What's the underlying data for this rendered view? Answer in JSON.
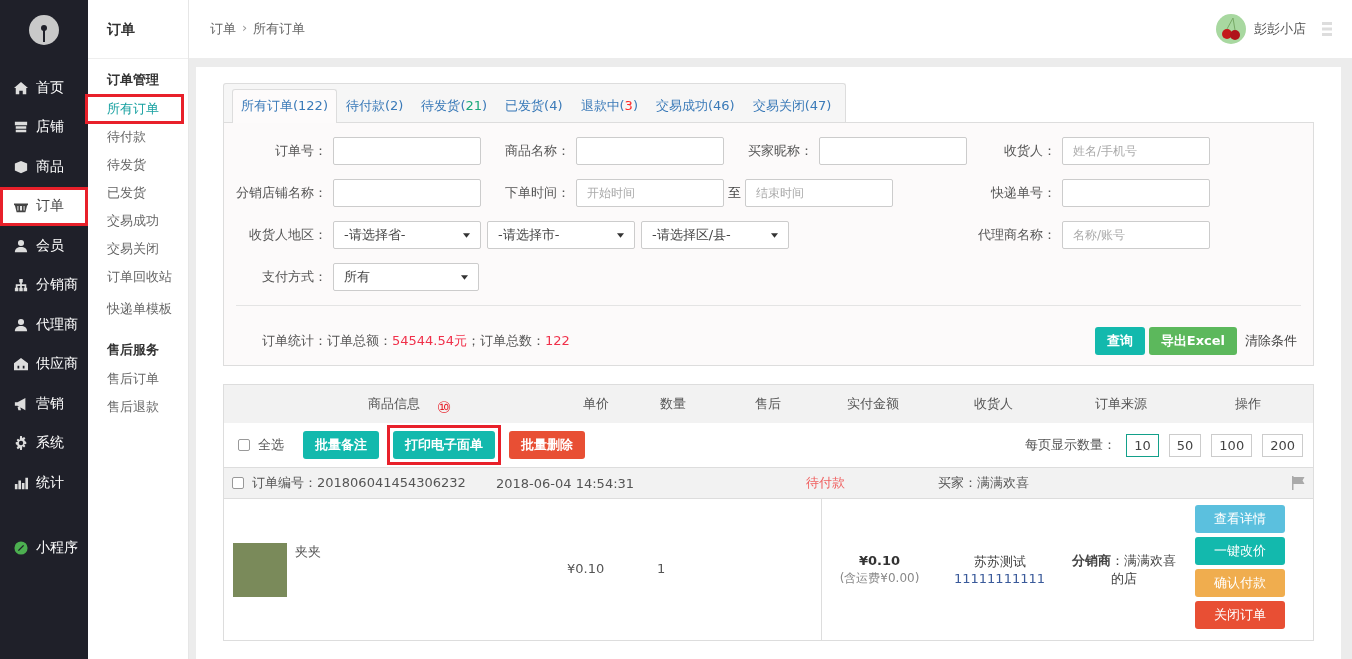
{
  "sidebar": {
    "items": [
      {
        "label": "首页",
        "selected": false,
        "highlighted": false
      },
      {
        "label": "店铺",
        "selected": false,
        "highlighted": false
      },
      {
        "label": "商品",
        "selected": false,
        "highlighted": false
      },
      {
        "label": "订单",
        "selected": true,
        "highlighted": true
      },
      {
        "label": "会员",
        "selected": false,
        "highlighted": false
      },
      {
        "label": "分销商",
        "selected": false,
        "highlighted": false
      },
      {
        "label": "代理商",
        "selected": false,
        "highlighted": false
      },
      {
        "label": "供应商",
        "selected": false,
        "highlighted": false
      },
      {
        "label": "营销",
        "selected": false,
        "highlighted": false
      },
      {
        "label": "系统",
        "selected": false,
        "highlighted": false
      },
      {
        "label": "统计",
        "selected": false,
        "highlighted": false
      }
    ],
    "extra": {
      "label": "小程序"
    }
  },
  "subnav": {
    "title": "订单",
    "groups": [
      {
        "title": "订单管理",
        "items": [
          {
            "label": "所有订单",
            "selected": true,
            "highlighted": true
          },
          {
            "label": "待付款",
            "selected": false,
            "highlighted": false
          },
          {
            "label": "待发货",
            "selected": false,
            "highlighted": false
          },
          {
            "label": "已发货",
            "selected": false,
            "highlighted": false
          },
          {
            "label": "交易成功",
            "selected": false,
            "highlighted": false
          },
          {
            "label": "交易关闭",
            "selected": false,
            "highlighted": false
          },
          {
            "label": "订单回收站",
            "selected": false,
            "highlighted": false
          },
          {
            "label": "快递单模板",
            "selected": false,
            "highlighted": false
          }
        ]
      },
      {
        "title": "售后服务",
        "items": [
          {
            "label": "售后订单",
            "selected": false,
            "highlighted": false
          },
          {
            "label": "售后退款",
            "selected": false,
            "highlighted": false
          }
        ]
      }
    ]
  },
  "breadcrumb": [
    "订单",
    "›",
    "所有订单"
  ],
  "user": {
    "name": "彭彭小店"
  },
  "tabs": [
    {
      "label": "所有订单(122)",
      "selected": true
    },
    {
      "label": "待付款(2)",
      "selected": false
    },
    {
      "label": "待发货(",
      "count": "21",
      "tail": ")",
      "color": "#1aa87a",
      "selected": false
    },
    {
      "label": "已发货(4)",
      "selected": false
    },
    {
      "label": "退款中(",
      "count": "3",
      "tail": ")",
      "color": "#ff2a2a",
      "selected": false
    },
    {
      "label": "交易成功(46)",
      "selected": false
    },
    {
      "label": "交易关闭(47)",
      "selected": false
    }
  ],
  "filters": [
    {
      "label": "订单号：",
      "kind": "input"
    },
    {
      "label": "商品名称：",
      "kind": "input"
    },
    {
      "label": "买家昵称：",
      "kind": "input"
    },
    {
      "label": "收货人：",
      "kind": "input",
      "placeholder": "姓名/手机号"
    },
    {
      "label": "分销店铺名称：",
      "kind": "input"
    },
    {
      "label": "下单时间：",
      "kind": "range",
      "start_placeholder": "开始时间",
      "separator": "至",
      "end_placeholder": "结束时间"
    },
    {
      "label": "快递单号：",
      "kind": "input"
    },
    {
      "label": "收货人地区：",
      "kind": "selects",
      "values": [
        "-请选择省-",
        "-请选择市-",
        "-请选择区/县-"
      ]
    },
    {
      "label": "代理商名称：",
      "kind": "input",
      "placeholder": "名称/账号"
    },
    {
      "label": "支付方式：",
      "kind": "select",
      "value": "所有"
    }
  ],
  "stats": {
    "label": "订单统计：",
    "total_label": "订单总额：",
    "total_value": "54544.54元",
    "count_label": "；订单总数：",
    "count_value": "122"
  },
  "filter_buttons": [
    {
      "label": "查询",
      "kind": "teal"
    },
    {
      "label": "导出Excel",
      "kind": "green"
    },
    {
      "label": "清除条件",
      "kind": "link"
    }
  ],
  "table": {
    "columns": [
      "商品信息",
      "单价",
      "数量",
      "售后",
      "实付金额",
      "收货人",
      "订单来源",
      "操作"
    ]
  },
  "toolbar": {
    "select_all": {
      "label": "全选",
      "checked": false
    },
    "buttons": [
      {
        "label": "批量备注",
        "kind": "teal",
        "highlighted": false
      },
      {
        "label": "打印电子面单",
        "kind": "teal",
        "highlighted": true,
        "callout": "⑩"
      },
      {
        "label": "批量删除",
        "kind": "red",
        "highlighted": false
      }
    ],
    "page_size_label": "每页显示数量：",
    "page_sizes": [
      {
        "label": "10",
        "selected": true
      },
      {
        "label": "50",
        "selected": false
      },
      {
        "label": "100",
        "selected": false
      },
      {
        "label": "200",
        "selected": false
      }
    ]
  },
  "orders": [
    {
      "checked": false,
      "number": "订单编号：201806041454306232",
      "time": "2018-06-04 14:54:31",
      "status": "待付款",
      "buyer": "买家：满满欢喜",
      "item": {
        "name": "夹夹",
        "price": "¥0.10",
        "quantity": "1"
      },
      "paid": "¥0.10",
      "shipping": "(含运费¥0.00)",
      "receiver": "苏苏测试",
      "phone": "11111111111",
      "source": "**分销商**：满满欢喜的店",
      "actions": [
        {
          "label": "查看详情",
          "kind": "blue"
        },
        {
          "label": "一键改价",
          "kind": "teal"
        },
        {
          "label": "确认付款",
          "kind": "orange"
        },
        {
          "label": "关闭订单",
          "kind": "red"
        }
      ]
    }
  ]
}
